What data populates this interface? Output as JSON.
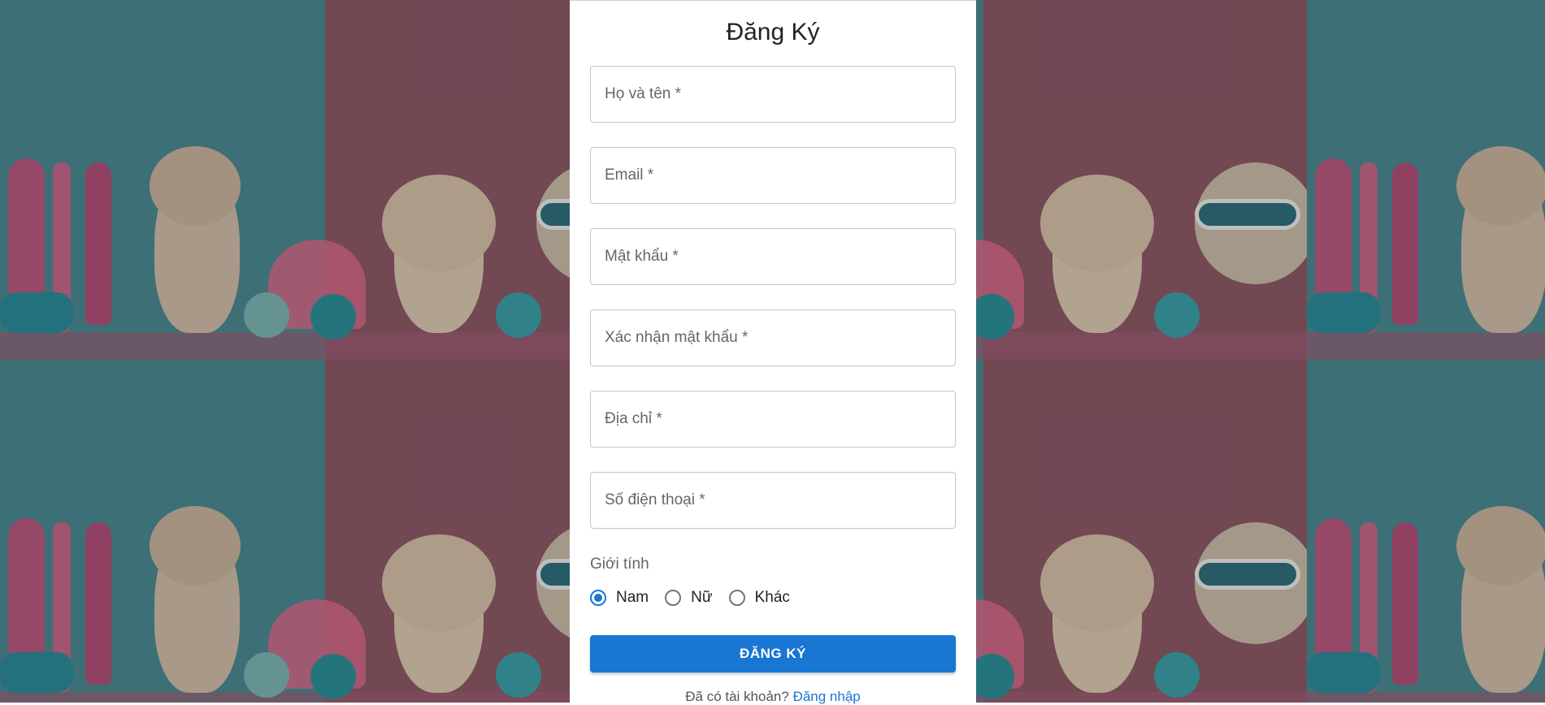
{
  "form": {
    "title": "Đăng Ký",
    "fields": [
      {
        "label": "Họ và tên *",
        "value": ""
      },
      {
        "label": "Email *",
        "value": ""
      },
      {
        "label": "Mật khẩu *",
        "value": ""
      },
      {
        "label": "Xác nhận mật khẩu *",
        "value": ""
      },
      {
        "label": "Địa chỉ *",
        "value": ""
      },
      {
        "label": "Số điện thoại *",
        "value": ""
      }
    ],
    "gender": {
      "label": "Giới tính",
      "options": [
        "Nam",
        "Nữ",
        "Khác"
      ],
      "selected": "Nam"
    },
    "submit_label": "ĐĂNG KÝ",
    "login_prompt": "Đã có tài khoản?",
    "login_link": "Đăng nhập"
  },
  "colors": {
    "primary": "#1976d2",
    "card_bg": "#ffffff"
  }
}
